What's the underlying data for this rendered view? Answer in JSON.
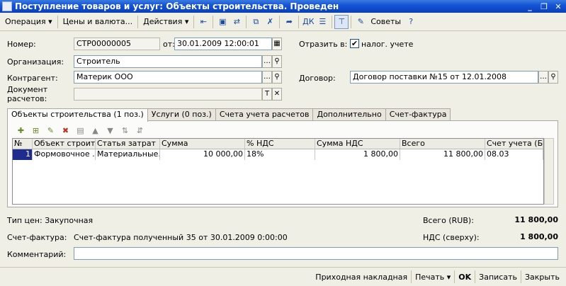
{
  "window": {
    "title": "Поступление товаров и услуг: Объекты строительства. Проведен",
    "minimize_glyph": "_",
    "maximize_glyph": "❐",
    "close_glyph": "✕"
  },
  "toolbar": {
    "operation": "Операция ▾",
    "prices_currency": "Цены и валюта...",
    "actions": "Действия ▾",
    "advice": "Советы",
    "help": "?"
  },
  "form": {
    "number_label": "Номер:",
    "number_value": "СТР00000005",
    "from_label": "от:",
    "date_value": "30.01.2009 12:00:01",
    "reflect_label": "Отразить в:",
    "tax_check_label": "налог. учете",
    "org_label": "Организация:",
    "org_value": "Строитель",
    "counterparty_label": "Контрагент:",
    "counterparty_value": "Материк ООО",
    "contract_label": "Договор:",
    "contract_value": "Договор поставки №15 от 12.01.2008",
    "settlement_doc_label": "Документ расчетов:",
    "settlement_doc_value": ""
  },
  "tabs": [
    {
      "label": "Объекты строительства (1 поз.)"
    },
    {
      "label": "Услуги (0 поз.)"
    },
    {
      "label": "Счета учета расчетов"
    },
    {
      "label": "Дополнительно"
    },
    {
      "label": "Счет-фактура"
    }
  ],
  "table": {
    "columns": [
      "№",
      "Объект строит...",
      "Статья затрат",
      "Сумма",
      "% НДС",
      "Сумма НДС",
      "Всего",
      "Счет учета (БУ)"
    ],
    "rows": [
      [
        "1",
        "Формовочное ...",
        "Материальные...",
        "10 000,00",
        "18%",
        "1 800,00",
        "11 800,00",
        "08.03"
      ]
    ]
  },
  "summary": {
    "price_type": "Тип цен: Закупочная",
    "total_label": "Всего (RUB):",
    "total_value": "11 800,00",
    "invoice_label": "Счет-фактура:",
    "invoice_value": "Счет-фактура полученный 35 от 30.01.2009 0:00:00",
    "vat_label": "НДС (сверху):",
    "vat_value": "1 800,00",
    "comment_label": "Комментарий:",
    "comment_value": ""
  },
  "footer": {
    "incoming_invoice": "Приходная накладная",
    "print": "Печать ▾",
    "ok": "OK",
    "save": "Записать",
    "close": "Закрыть"
  },
  "colors": {
    "title_bar": "#1554d6",
    "selected_row": "#1f2c8e"
  }
}
